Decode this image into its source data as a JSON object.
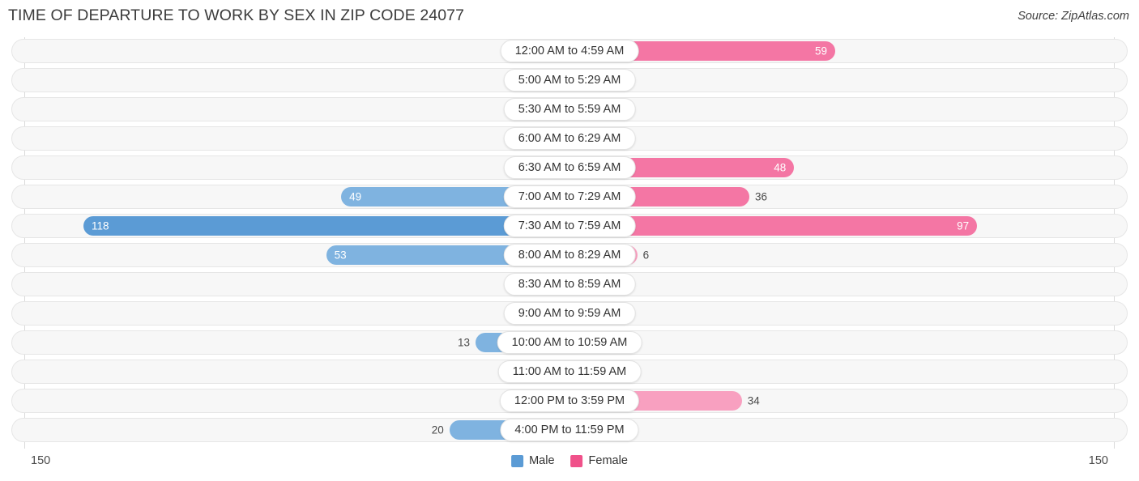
{
  "header": {
    "title": "TIME OF DEPARTURE TO WORK BY SEX IN ZIP CODE 24077",
    "source": "Source: ZipAtlas.com"
  },
  "axis": {
    "max_left": "150",
    "max_right": "150"
  },
  "legend": [
    {
      "label": "Male",
      "color": "#5b9bd5"
    },
    {
      "label": "Female",
      "color": "#f0518a"
    }
  ],
  "colors": {
    "male_strong": "#5b9bd5",
    "male_light": "#a8cbe8",
    "female_strong": "#f0518a",
    "female_mid": "#f476a4",
    "female_light": "#f8a0c0",
    "track": "#f7f7f7",
    "track_border": "#e6e6e6",
    "axis_line": "#d9d9d9"
  },
  "chart_data": {
    "type": "bar",
    "title": "TIME OF DEPARTURE TO WORK BY SEX IN ZIP CODE 24077",
    "subtitle": "Source: ZipAtlas.com",
    "orientation": "horizontal-diverging",
    "xlabel": "",
    "ylabel": "",
    "xlim": [
      150,
      150
    ],
    "grid": false,
    "legend_position": "bottom-center",
    "categories": [
      "12:00 AM to 4:59 AM",
      "5:00 AM to 5:29 AM",
      "5:30 AM to 5:59 AM",
      "6:00 AM to 6:29 AM",
      "6:30 AM to 6:59 AM",
      "7:00 AM to 7:29 AM",
      "7:30 AM to 7:59 AM",
      "8:00 AM to 8:29 AM",
      "8:30 AM to 8:59 AM",
      "9:00 AM to 9:59 AM",
      "10:00 AM to 10:59 AM",
      "11:00 AM to 11:59 AM",
      "12:00 PM to 3:59 PM",
      "4:00 PM to 11:59 PM"
    ],
    "series": [
      {
        "name": "Male",
        "values": [
          0,
          0,
          0,
          0,
          0,
          49,
          118,
          53,
          0,
          0,
          13,
          0,
          0,
          20
        ]
      },
      {
        "name": "Female",
        "values": [
          59,
          0,
          0,
          0,
          48,
          36,
          97,
          6,
          0,
          0,
          0,
          0,
          34,
          0
        ]
      }
    ]
  },
  "rows": [
    {
      "category": "12:00 AM to 4:59 AM",
      "male": "0",
      "female": "59"
    },
    {
      "category": "5:00 AM to 5:29 AM",
      "male": "0",
      "female": "0"
    },
    {
      "category": "5:30 AM to 5:59 AM",
      "male": "0",
      "female": "0"
    },
    {
      "category": "6:00 AM to 6:29 AM",
      "male": "0",
      "female": "0"
    },
    {
      "category": "6:30 AM to 6:59 AM",
      "male": "0",
      "female": "48"
    },
    {
      "category": "7:00 AM to 7:29 AM",
      "male": "49",
      "female": "36"
    },
    {
      "category": "7:30 AM to 7:59 AM",
      "male": "118",
      "female": "97"
    },
    {
      "category": "8:00 AM to 8:29 AM",
      "male": "53",
      "female": "6"
    },
    {
      "category": "8:30 AM to 8:59 AM",
      "male": "0",
      "female": "0"
    },
    {
      "category": "9:00 AM to 9:59 AM",
      "male": "0",
      "female": "0"
    },
    {
      "category": "10:00 AM to 10:59 AM",
      "male": "13",
      "female": "0"
    },
    {
      "category": "11:00 AM to 11:59 AM",
      "male": "0",
      "female": "0"
    },
    {
      "category": "12:00 PM to 3:59 PM",
      "male": "0",
      "female": "34"
    },
    {
      "category": "4:00 PM to 11:59 PM",
      "male": "20",
      "female": "0"
    }
  ]
}
